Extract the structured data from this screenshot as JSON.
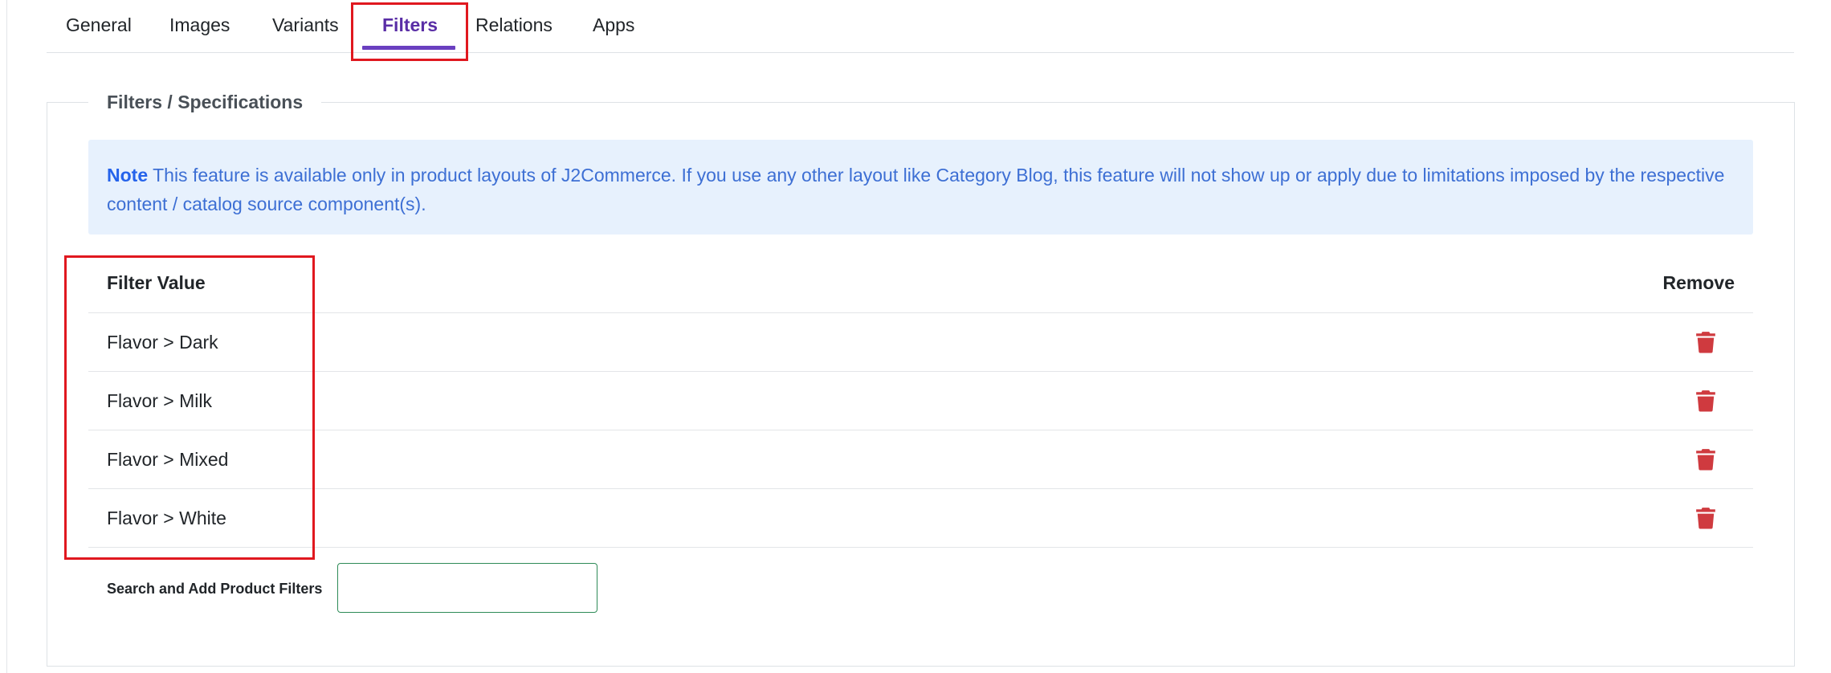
{
  "tabs": [
    {
      "label": "General",
      "active": false
    },
    {
      "label": "Images",
      "active": false
    },
    {
      "label": "Variants",
      "active": false
    },
    {
      "label": "Filters",
      "active": true
    },
    {
      "label": "Relations",
      "active": false
    },
    {
      "label": "Apps",
      "active": false
    }
  ],
  "section": {
    "legend": "Filters / Specifications"
  },
  "note": {
    "label": "Note",
    "text": " This feature is available only in product layouts of J2Commerce. If you use any other layout like Category Blog, this feature will not show up or apply due to limitations imposed by the respective content / catalog source component(s)."
  },
  "table": {
    "headers": {
      "filter_value": "Filter Value",
      "remove": "Remove"
    },
    "rows": [
      {
        "value": "Flavor > Dark",
        "remove_icon": "trash-icon"
      },
      {
        "value": "Flavor > Milk",
        "remove_icon": "trash-icon"
      },
      {
        "value": "Flavor > Mixed",
        "remove_icon": "trash-icon"
      },
      {
        "value": "Flavor > White",
        "remove_icon": "trash-icon"
      }
    ]
  },
  "search": {
    "label": "Search and Add Product Filters",
    "value": "",
    "placeholder": ""
  },
  "colors": {
    "active_tab": "#5a2ea6",
    "tab_underline": "#6a3fc0",
    "note_bg": "#e7f1fd",
    "note_text": "#3d6fd4",
    "trash": "#cf3a3f",
    "highlight": "#e0181f",
    "input_border": "#2e8b57"
  }
}
